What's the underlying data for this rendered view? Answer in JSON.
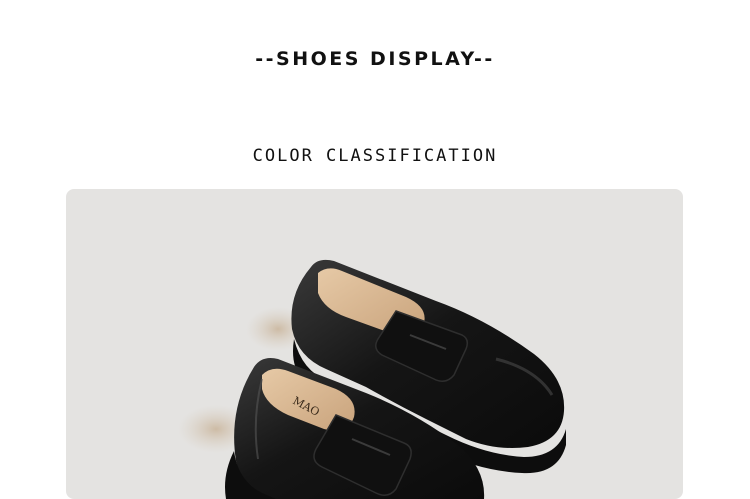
{
  "header": {
    "title": "--SHOES DISPLAY--",
    "subtitle": "COLOR CLASSIFICATION"
  },
  "product_image": {
    "subject": "black leather penny loafers with chunky platform soles",
    "brand_mark": "MAO",
    "background_color": "#e4e3e1",
    "shoe_color": "#141414",
    "insole_color": "#d8b894"
  }
}
